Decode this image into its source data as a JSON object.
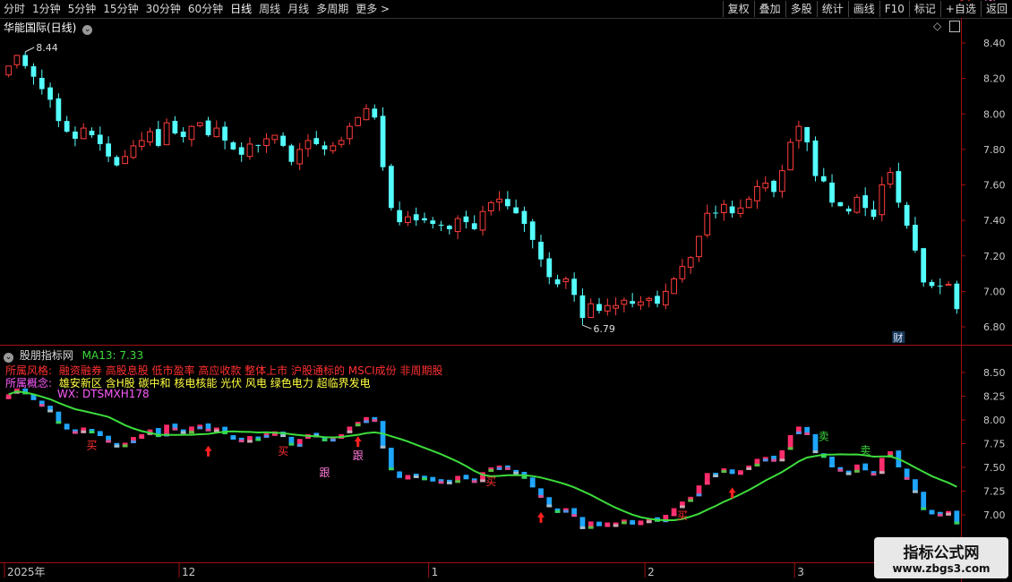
{
  "toolbar": {
    "periods": [
      "分时",
      "1分钟",
      "5分钟",
      "15分钟",
      "30分钟",
      "60分钟",
      "日线",
      "周线",
      "月线",
      "多周期",
      "更多 >"
    ],
    "active_period": "日线",
    "right_buttons": [
      "复权",
      "叠加",
      "多股",
      "统计",
      "画线",
      "F10",
      "标记",
      "+自选",
      "返回"
    ]
  },
  "main_panel": {
    "title": "华能国际(日线)",
    "high_label": "8.44",
    "low_label": "6.79",
    "fin_badge": "财",
    "y_ticks": [
      "8.40",
      "8.20",
      "8.00",
      "7.80",
      "7.60",
      "7.40",
      "7.20",
      "7.00",
      "6.80"
    ],
    "y_values": [
      8.4,
      8.2,
      8.0,
      7.8,
      7.6,
      7.4,
      7.2,
      7.0,
      6.8
    ]
  },
  "indicator_panel": {
    "title": "股朋指标网",
    "ma_label": "MA13: 7.33",
    "line1_label": "所属风格:",
    "line1_text": "融资融券 高股息股 低市盈率 高应收款 整体上市 沪股通标的 MSCI成份 非周期股",
    "line2_label": "所属概念:",
    "line2_text": "雄安新区 含H股 碳中和 核电核能 光伏 风电 绿色电力 超临界发电",
    "wx_text": "WX: DTSMXH178",
    "y_ticks": [
      "8.50",
      "8.25",
      "8.00",
      "7.75",
      "7.50",
      "7.25",
      "7.00"
    ],
    "y_values": [
      8.5,
      8.25,
      8.0,
      7.75,
      7.5,
      7.25,
      7.0
    ],
    "signals": [
      {
        "text": "买",
        "i": 10,
        "kind": "buy"
      },
      {
        "text": "买",
        "i": 33,
        "kind": "buy"
      },
      {
        "text": "买",
        "i": 58,
        "kind": "buy"
      },
      {
        "text": "买",
        "i": 81,
        "kind": "buy"
      },
      {
        "text": "买",
        "i": 115,
        "kind": "buy"
      },
      {
        "text": "跟",
        "i": 38,
        "kind": "follow"
      },
      {
        "text": "跟",
        "i": 42,
        "kind": "follow"
      },
      {
        "text": "跟",
        "i": 118,
        "kind": "follow"
      },
      {
        "text": "卖",
        "i": 98,
        "kind": "sell"
      },
      {
        "text": "卖",
        "i": 103,
        "kind": "sell"
      }
    ],
    "arrows": [
      24,
      42,
      64,
      87
    ]
  },
  "x_axis": {
    "labels": [
      {
        "text": "2025年",
        "i": 0
      },
      {
        "text": "12",
        "i": 21
      },
      {
        "text": "1",
        "i": 51
      },
      {
        "text": "2",
        "i": 77
      },
      {
        "text": "3",
        "i": 95
      }
    ]
  },
  "watermark": {
    "line1": "指标公式网",
    "line2": "www.zbgs3.com"
  },
  "colors": {
    "up": "#ff3c3c",
    "down": "#54ffff",
    "ma": "#3cdc3c",
    "axis": "#c8c8c8",
    "border": "#a01010"
  },
  "chart_data": {
    "type": "candlestick",
    "close": [
      8.27,
      8.33,
      8.27,
      8.21,
      8.14,
      8.08,
      7.96,
      7.9,
      7.86,
      7.92,
      7.88,
      7.83,
      7.76,
      7.71,
      7.76,
      7.82,
      7.85,
      7.9,
      7.82,
      7.95,
      7.89,
      7.87,
      7.93,
      7.95,
      7.88,
      7.92,
      7.85,
      7.8,
      7.77,
      7.83,
      7.82,
      7.86,
      7.88,
      7.82,
      7.73,
      7.8,
      7.85,
      7.83,
      7.8,
      7.82,
      7.85,
      7.93,
      7.98,
      8.03,
      7.98,
      7.7,
      7.47,
      7.39,
      7.42,
      7.4,
      7.4,
      7.38,
      7.37,
      7.35,
      7.41,
      7.39,
      7.35,
      7.45,
      7.5,
      7.52,
      7.48,
      7.44,
      7.38,
      7.29,
      7.18,
      7.08,
      7.04,
      7.07,
      6.98,
      6.85,
      6.93,
      6.89,
      6.92,
      6.92,
      6.95,
      6.93,
      6.94,
      6.96,
      6.93,
      7.0,
      7.07,
      7.14,
      7.19,
      7.31,
      7.44,
      7.44,
      7.49,
      7.44,
      7.47,
      7.52,
      7.59,
      7.61,
      7.56,
      7.68,
      7.84,
      7.93,
      7.84,
      7.65,
      7.62,
      7.5,
      7.48,
      7.45,
      7.53,
      7.47,
      7.42,
      7.6,
      7.67,
      7.5,
      7.37,
      7.23,
      7.05,
      7.03,
      7.03,
      7.04,
      6.9
    ]
  }
}
